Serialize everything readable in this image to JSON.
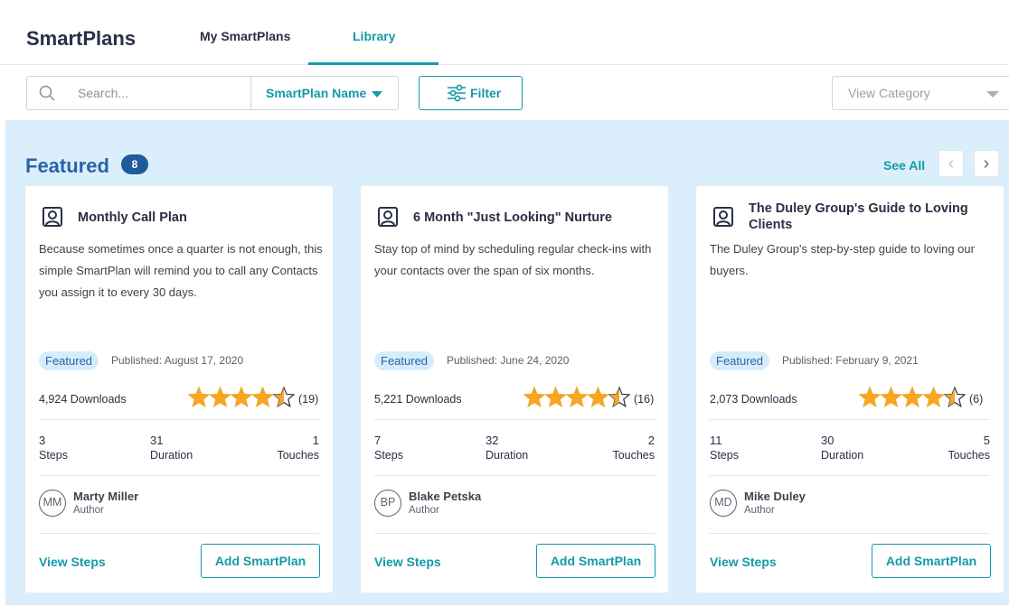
{
  "header": {
    "brand": "SmartPlans",
    "tabs": [
      {
        "label": "My SmartPlans"
      },
      {
        "label": "Library"
      }
    ]
  },
  "toolbar": {
    "search_placeholder": "Search...",
    "search_field": "SmartPlan Name",
    "filter_label": "Filter",
    "category_placeholder": "View Category"
  },
  "featured": {
    "title": "Featured",
    "count": "8",
    "see_all": "See All",
    "cards": [
      {
        "title": "Monthly Call Plan",
        "description": "Because sometimes once a quarter is not enough, this simple SmartPlan will remind you to call any Contacts you assign it to every 30 days.",
        "tag": "Featured",
        "published": "Published: August 17, 2020",
        "downloads": "4,924 Downloads",
        "rating": 4.5,
        "rating_count": "(19)",
        "steps": "3",
        "steps_label": "Steps",
        "duration": "31",
        "duration_label": "Duration",
        "touches": "1",
        "touches_label": "Touches",
        "author_initials": "MM",
        "author_name": "Marty Miller",
        "author_role": "Author",
        "view_steps": "View Steps",
        "add_label": "Add SmartPlan"
      },
      {
        "title": "6 Month \"Just Looking\" Nurture",
        "description": "Stay top of mind by scheduling regular check-ins with your contacts over the span of six months.",
        "tag": "Featured",
        "published": "Published: June 24, 2020",
        "downloads": "5,221 Downloads",
        "rating": 4.5,
        "rating_count": "(16)",
        "steps": "7",
        "steps_label": "Steps",
        "duration": "32",
        "duration_label": "Duration",
        "touches": "2",
        "touches_label": "Touches",
        "author_initials": "BP",
        "author_name": "Blake Petska",
        "author_role": "Author",
        "view_steps": "View Steps",
        "add_label": "Add SmartPlan"
      },
      {
        "title": "The Duley Group's Guide to Loving Clients",
        "description": "The Duley Group's step-by-step guide to loving our buyers.",
        "tag": "Featured",
        "published": "Published: February 9, 2021",
        "downloads": "2,073 Downloads",
        "rating": 4.5,
        "rating_count": "(6)",
        "steps": "11",
        "steps_label": "Steps",
        "duration": "30",
        "duration_label": "Duration",
        "touches": "5",
        "touches_label": "Touches",
        "author_initials": "MD",
        "author_name": "Mike Duley",
        "author_role": "Author",
        "view_steps": "View Steps",
        "add_label": "Add SmartPlan"
      }
    ]
  },
  "colors": {
    "accent": "#139aa8",
    "featured_bg": "#dbeefc",
    "star": "#f5a623",
    "title_blue": "#2a64a6"
  }
}
